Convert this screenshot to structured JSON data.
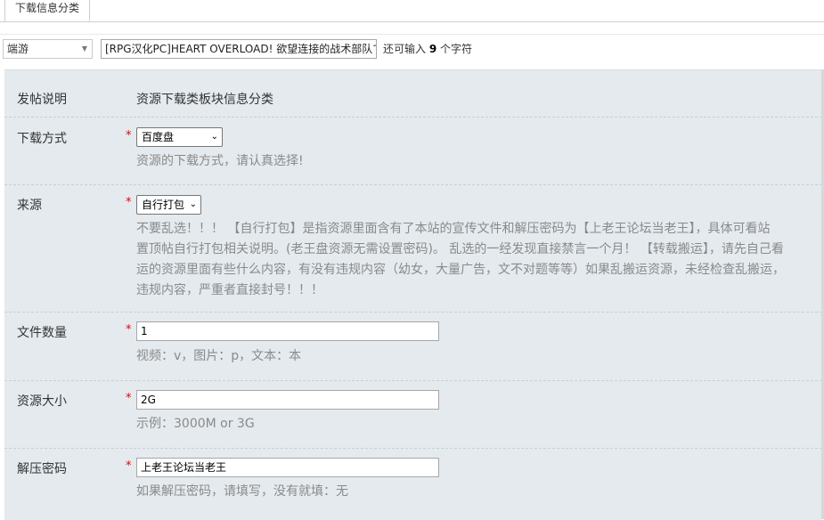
{
  "tab": {
    "label": "下载信息分类"
  },
  "toolbar": {
    "type_select": "端游",
    "title_value": "[RPG汉化PC]HEART OVERLOAD! 欲望连接的战术部队で",
    "char_note_prefix": "还可输入",
    "char_remaining": "9",
    "char_note_suffix": "个字符"
  },
  "rows": {
    "desc": {
      "label": "发帖说明",
      "value": "资源下载类板块信息分类"
    },
    "download": {
      "label": "下载方式",
      "star": "*",
      "selected": "百度盘",
      "hint": "资源的下载方式，请认真选择!"
    },
    "source": {
      "label": "来源",
      "star": "*",
      "selected": "自行打包",
      "hint_lines": [
        "不要乱选！！！ 【自行打包】是指资源里面含有了本站的宣传文件和解压密码为【上老王论坛当老王】，具体可看站",
        "置顶帖自行打包相关说明。(老王盘资源无需设置密码)。 乱选的一经发现直接禁言一个月！ 【转载搬运】，请先自己看",
        "运的资源里面有些什么内容，有没有违规内容（幼女，大量广告，文不对题等等）如果乱搬运资源，未经检查乱搬运，",
        "违规内容，严重者直接封号！！！"
      ]
    },
    "filecount": {
      "label": "文件数量",
      "star": "*",
      "value": "1",
      "hint": "视频：v，图片：p，文本：本"
    },
    "size": {
      "label": "资源大小",
      "star": "*",
      "value": "2G",
      "hint": "示例：3000M or 3G"
    },
    "password": {
      "label": "解压密码",
      "star": "*",
      "value": "上老王论坛当老王",
      "hint": "如果解压密码，请填写，没有就填：无"
    }
  }
}
